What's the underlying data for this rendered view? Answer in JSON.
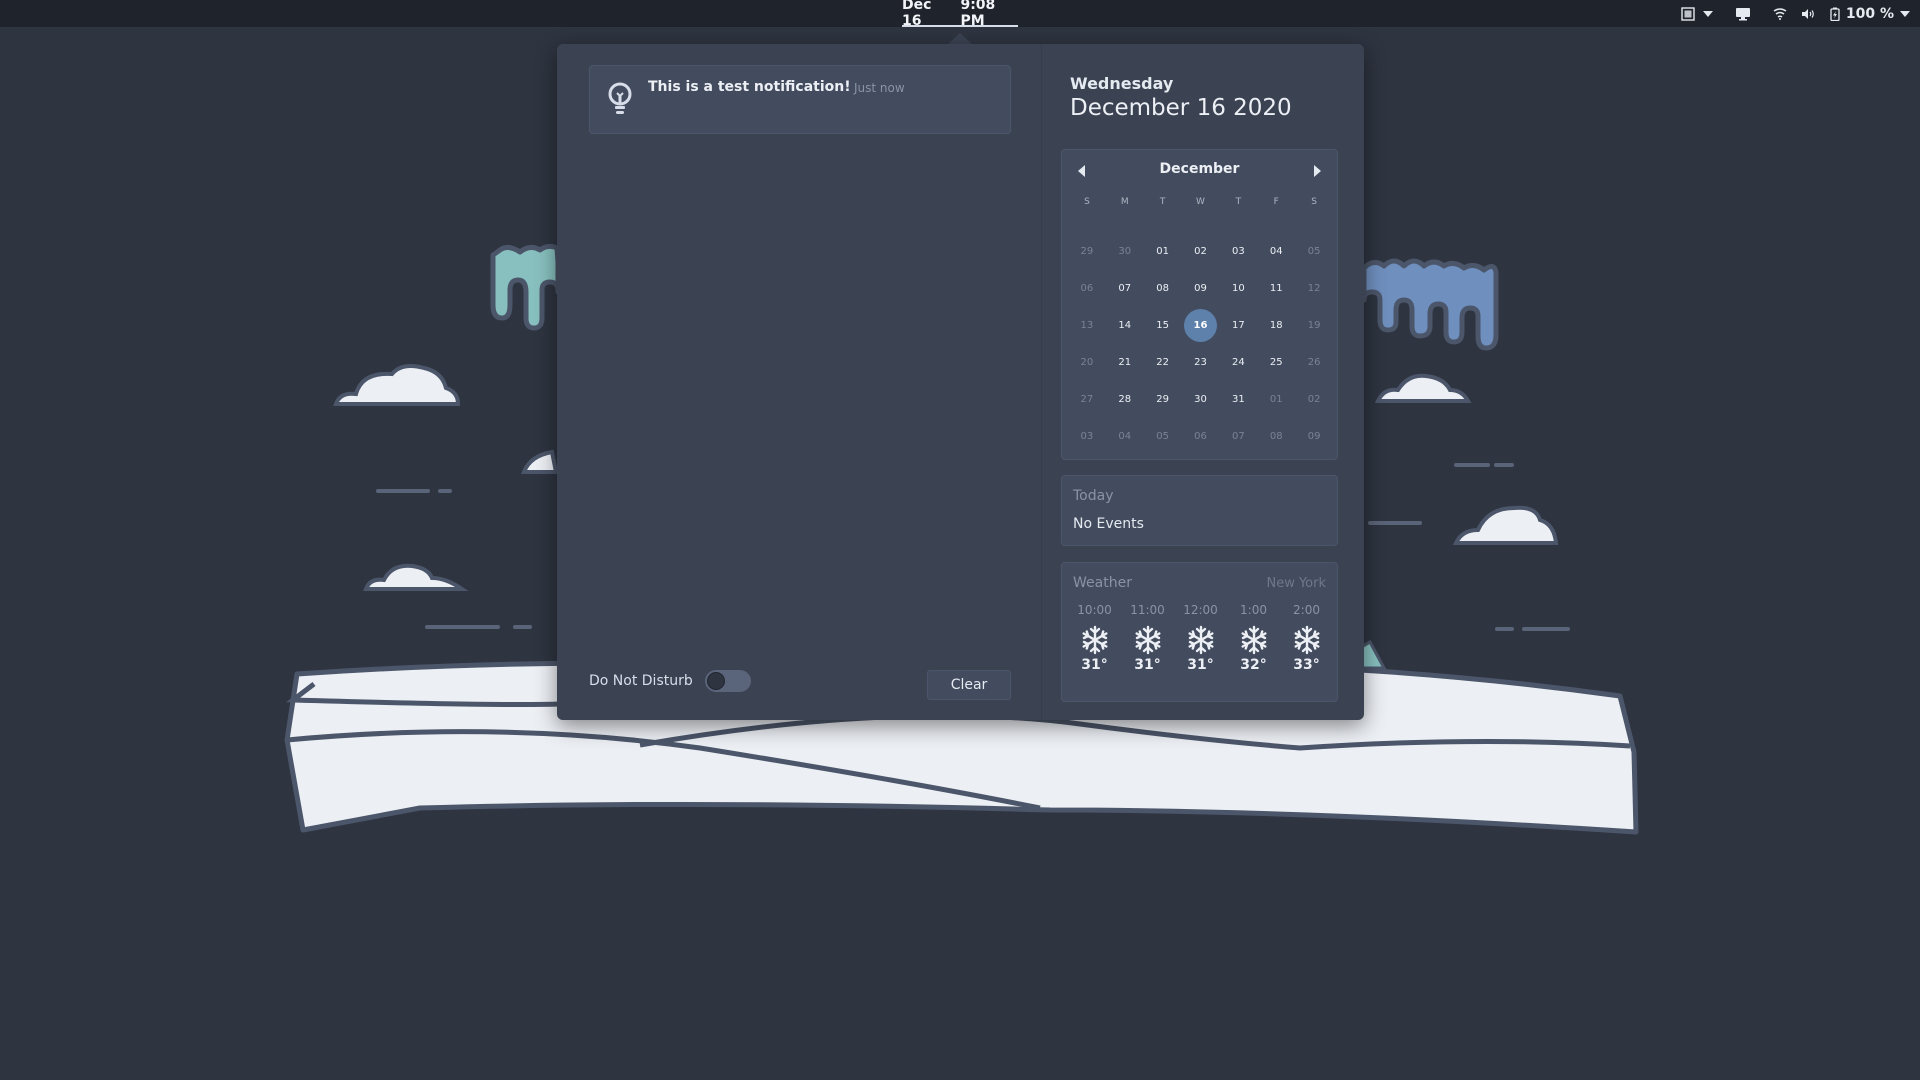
{
  "topbar": {
    "date": "Dec 16",
    "time": "9:08 PM",
    "battery_label": "100 %"
  },
  "notifications": [
    {
      "title": "This is a test notification!",
      "time": "Just now",
      "icon": "lightbulb-icon"
    }
  ],
  "footer": {
    "dnd_label": "Do Not Disturb",
    "dnd_enabled": "false",
    "clear_label": "Clear"
  },
  "date_header": {
    "weekday": "Wednesday",
    "full_date": "December 16 2020"
  },
  "calendar": {
    "month": "December",
    "weekdays": [
      "S",
      "M",
      "T",
      "W",
      "T",
      "F",
      "S"
    ],
    "weeks": [
      [
        "29",
        "30",
        "01",
        "02",
        "03",
        "04",
        "05"
      ],
      [
        "06",
        "07",
        "08",
        "09",
        "10",
        "11",
        "12"
      ],
      [
        "13",
        "14",
        "15",
        "16",
        "17",
        "18",
        "19"
      ],
      [
        "20",
        "21",
        "22",
        "23",
        "24",
        "25",
        "26"
      ],
      [
        "27",
        "28",
        "29",
        "30",
        "31",
        "01",
        "02"
      ],
      [
        "03",
        "04",
        "05",
        "06",
        "07",
        "08",
        "09"
      ]
    ],
    "selected_day": "16"
  },
  "events": {
    "title": "Today",
    "empty_text": "No Events"
  },
  "weather": {
    "title": "Weather",
    "city": "New York",
    "forecast": [
      {
        "time": "10:00",
        "temp": "31°",
        "icon": "snowflake-icon"
      },
      {
        "time": "11:00",
        "temp": "31°",
        "icon": "snowflake-icon"
      },
      {
        "time": "12:00",
        "temp": "31°",
        "icon": "snowflake-icon"
      },
      {
        "time": "1:00",
        "temp": "32°",
        "icon": "snowflake-icon"
      },
      {
        "time": "2:00",
        "temp": "33°",
        "icon": "snowflake-icon"
      }
    ]
  },
  "colors": {
    "background": "#2e3440",
    "topbar": "#1f232b",
    "popover": "#3b4252",
    "panel": "#434c5e",
    "accent": "#5e81ac"
  }
}
